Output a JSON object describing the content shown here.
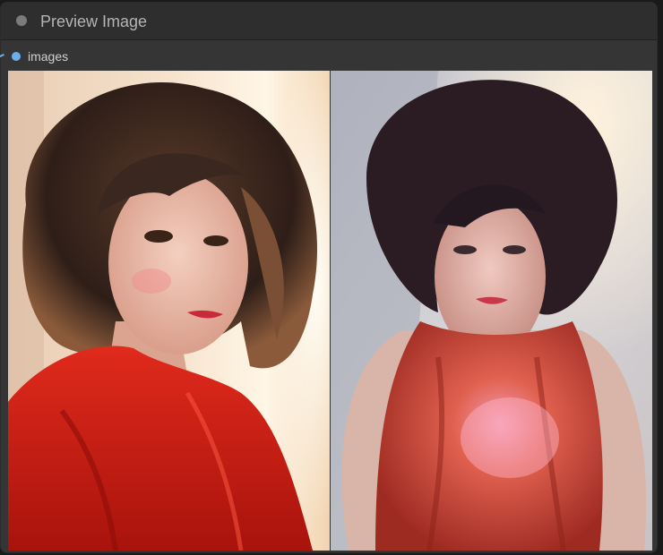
{
  "node": {
    "title": "Preview Image",
    "inputs": [
      {
        "label": "images",
        "color": "#6ab0f0"
      }
    ]
  },
  "preview": {
    "images": [
      {
        "icon": "portrait-red-dress-warm-light"
      },
      {
        "icon": "portrait-red-dress-cool-light"
      }
    ]
  },
  "colors": {
    "node_bg": "#353535",
    "header_bg": "#2e2e2e",
    "title_text": "#b4b4b4",
    "input_dot": "#6ab0f0"
  }
}
